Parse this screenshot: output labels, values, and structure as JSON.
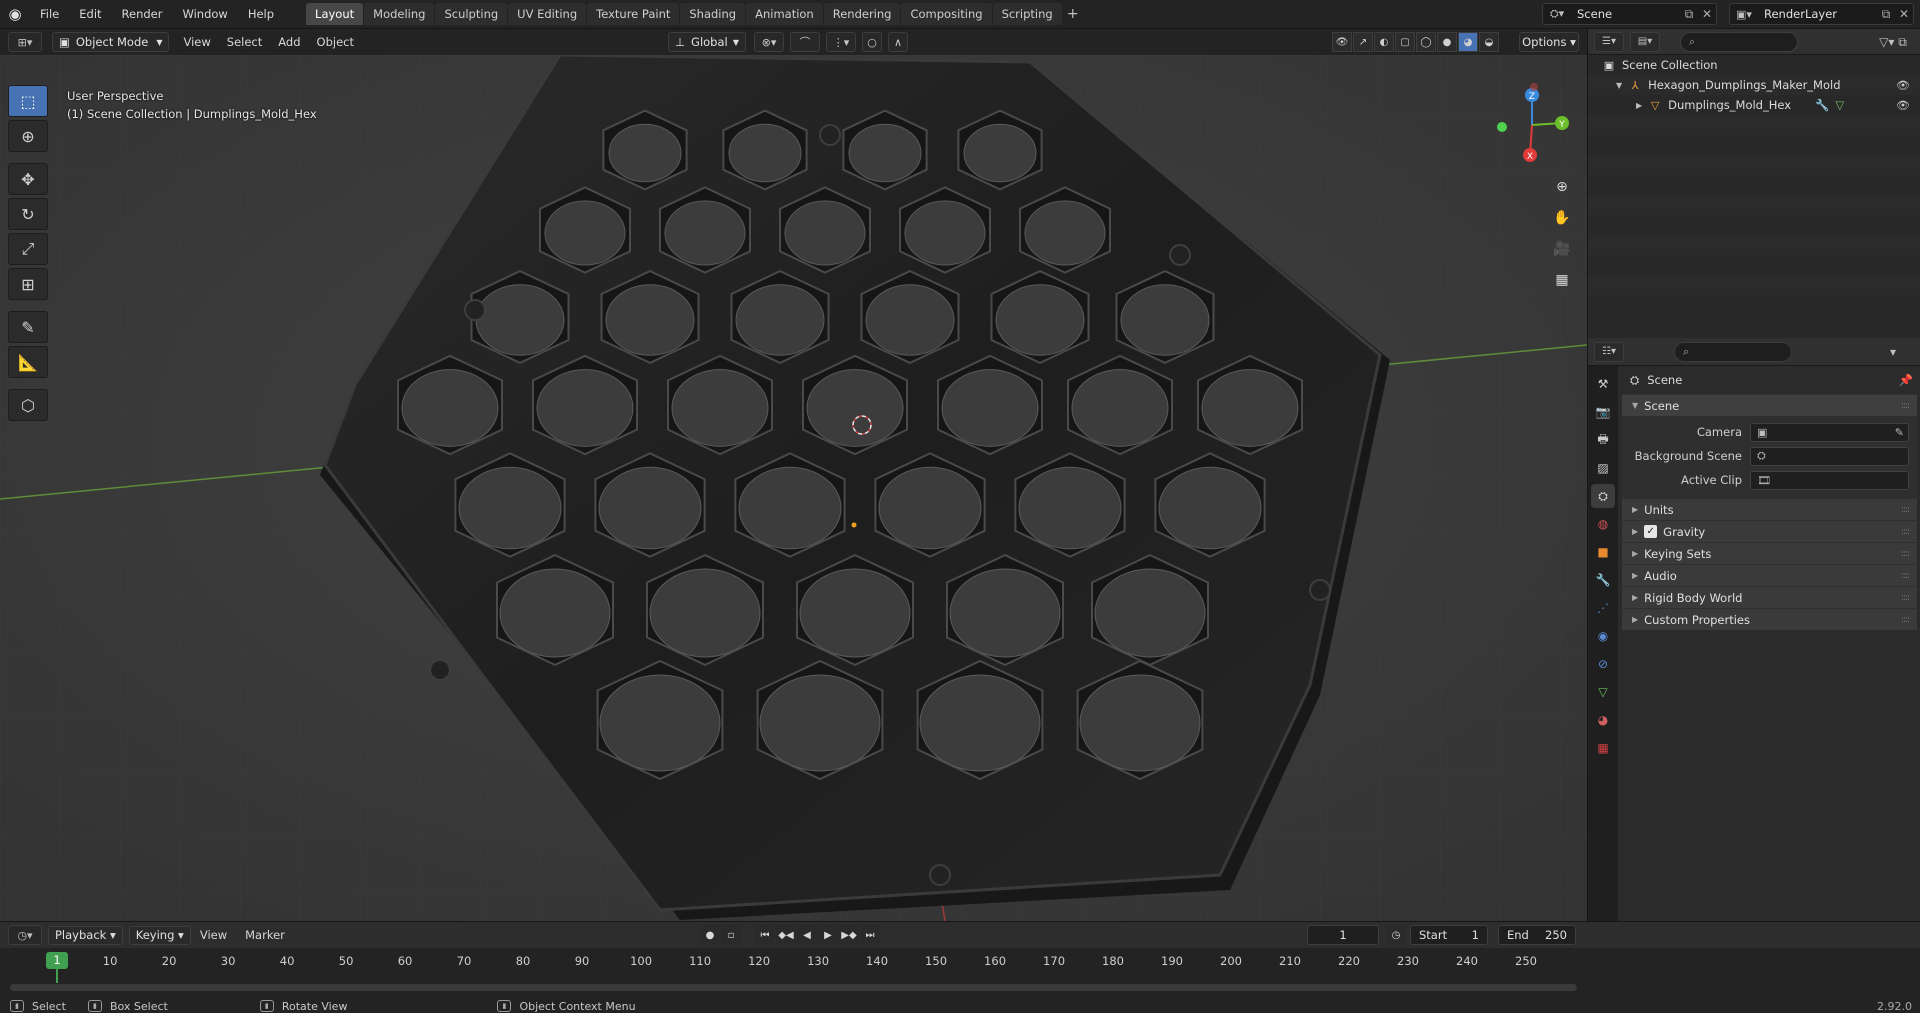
{
  "topbar": {
    "menus": [
      "File",
      "Edit",
      "Render",
      "Window",
      "Help"
    ],
    "workspaces": [
      "Layout",
      "Modeling",
      "Sculpting",
      "UV Editing",
      "Texture Paint",
      "Shading",
      "Animation",
      "Rendering",
      "Compositing",
      "Scripting"
    ],
    "active_workspace": "Layout",
    "add_tab": "+",
    "scene_name": "Scene",
    "view_layer": "RenderLayer"
  },
  "viewport": {
    "mode": "Object Mode",
    "menus": [
      "View",
      "Select",
      "Add",
      "Object"
    ],
    "transform_orientation": "Global",
    "options_label": "Options",
    "perspective_label": "User Perspective",
    "collection_label": "(1) Scene Collection | Dumplings_Mold_Hex",
    "gizmo": {
      "x": "X",
      "y": "Y",
      "z": "Z"
    }
  },
  "outliner": {
    "search_placeholder": "",
    "root": "Scene Collection",
    "collection": "Hexagon_Dumplings_Maker_Mold",
    "object": "Dumplings_Mold_Hex"
  },
  "properties": {
    "context": "Scene",
    "panel_scene": "Scene",
    "fields": [
      {
        "label": "Camera",
        "value": ""
      },
      {
        "label": "Background Scene",
        "value": ""
      },
      {
        "label": "Active Clip",
        "value": ""
      }
    ],
    "subpanels": [
      "Units",
      "Gravity",
      "Keying Sets",
      "Audio",
      "Rigid Body World",
      "Custom Properties"
    ],
    "gravity_checked": true
  },
  "timeline": {
    "playback": "Playback",
    "keying": "Keying",
    "view": "View",
    "marker": "Marker",
    "current_frame": "1",
    "start_label": "Start",
    "start": "1",
    "end_label": "End",
    "end": "250",
    "ruler_marks": [
      "1",
      "10",
      "20",
      "30",
      "40",
      "50",
      "60",
      "70",
      "80",
      "90",
      "100",
      "110",
      "120",
      "130",
      "140",
      "150",
      "160",
      "170",
      "180",
      "190",
      "200",
      "210",
      "220",
      "230",
      "240",
      "250"
    ]
  },
  "statusbar": {
    "select": "Select",
    "box_select": "Box Select",
    "rotate_view": "Rotate View",
    "context_menu": "Object Context Menu",
    "version": "2.92.0"
  },
  "colors": {
    "accent": "#4772b3",
    "frame_green": "#42a052",
    "axis_x": "#e03a3a",
    "axis_y": "#6cbf2b",
    "axis_z": "#3a8ae0"
  }
}
